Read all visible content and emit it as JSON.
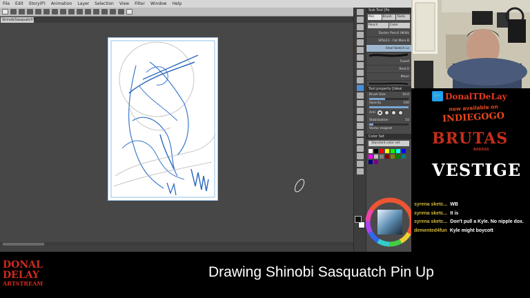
{
  "menu": [
    "File",
    "Edit",
    "Story(P)",
    "Animation",
    "Layer",
    "Selection",
    "View",
    "Filter",
    "Window",
    "Help"
  ],
  "tab_title": "ShinobiSasquatch*",
  "subtool_panel": {
    "header": "Sub Tool [Pe",
    "tabs": [
      "Pen",
      "Brush",
      "Taste",
      "Pencil",
      "Color"
    ],
    "brushes": [
      "Darker Pencil (Millik",
      "SPSLE1 - Fat More B",
      "Ideal-Sketch Lo",
      "Fused",
      "Real G",
      "Moon"
    ]
  },
  "tool_property": {
    "header": "Tool property [Ideal",
    "brush_size_label": "Brush Size",
    "brush_size_value": "10.0",
    "opacity_label": "Opacity",
    "opacity_value": "100",
    "anti_label": "Anti",
    "stabilization_label": "Stabilization",
    "stabilization_value": "10",
    "vector_label": "Vector magnet"
  },
  "color_set": {
    "header": "Color Set",
    "selected": "Standard color set",
    "colors": [
      "#ffffff",
      "#000000",
      "#ff0000",
      "#ffff00",
      "#00ff00",
      "#00ffff",
      "#0000ff",
      "#ff00ff",
      "#c0c0c0",
      "#808080",
      "#800000",
      "#808000",
      "#008000",
      "#008080",
      "#000080",
      "#800080"
    ]
  },
  "overlay": {
    "twitter_handle": "DonalTDeLay",
    "now_available": "now available on",
    "indiegogo": "INDIEGOGO",
    "brutas": "BRUTAS",
    "badass": "BADASS",
    "vestige": "VESTIGE"
  },
  "chat": [
    {
      "user": "syrena sketc...",
      "text": "WB"
    },
    {
      "user": "syrena sketc...",
      "text": "It is"
    },
    {
      "user": "syrena sketc...",
      "text": "Don't pull a Kyle. No nipple dox."
    },
    {
      "user": "demented4fun",
      "text": "Kyle might boycott"
    }
  ],
  "logo": {
    "line1": "DONAL",
    "line2": "DELAY",
    "line3": "ARTSTREAM"
  },
  "stream_title": "Drawing Shinobi Sasquatch Pin Up"
}
